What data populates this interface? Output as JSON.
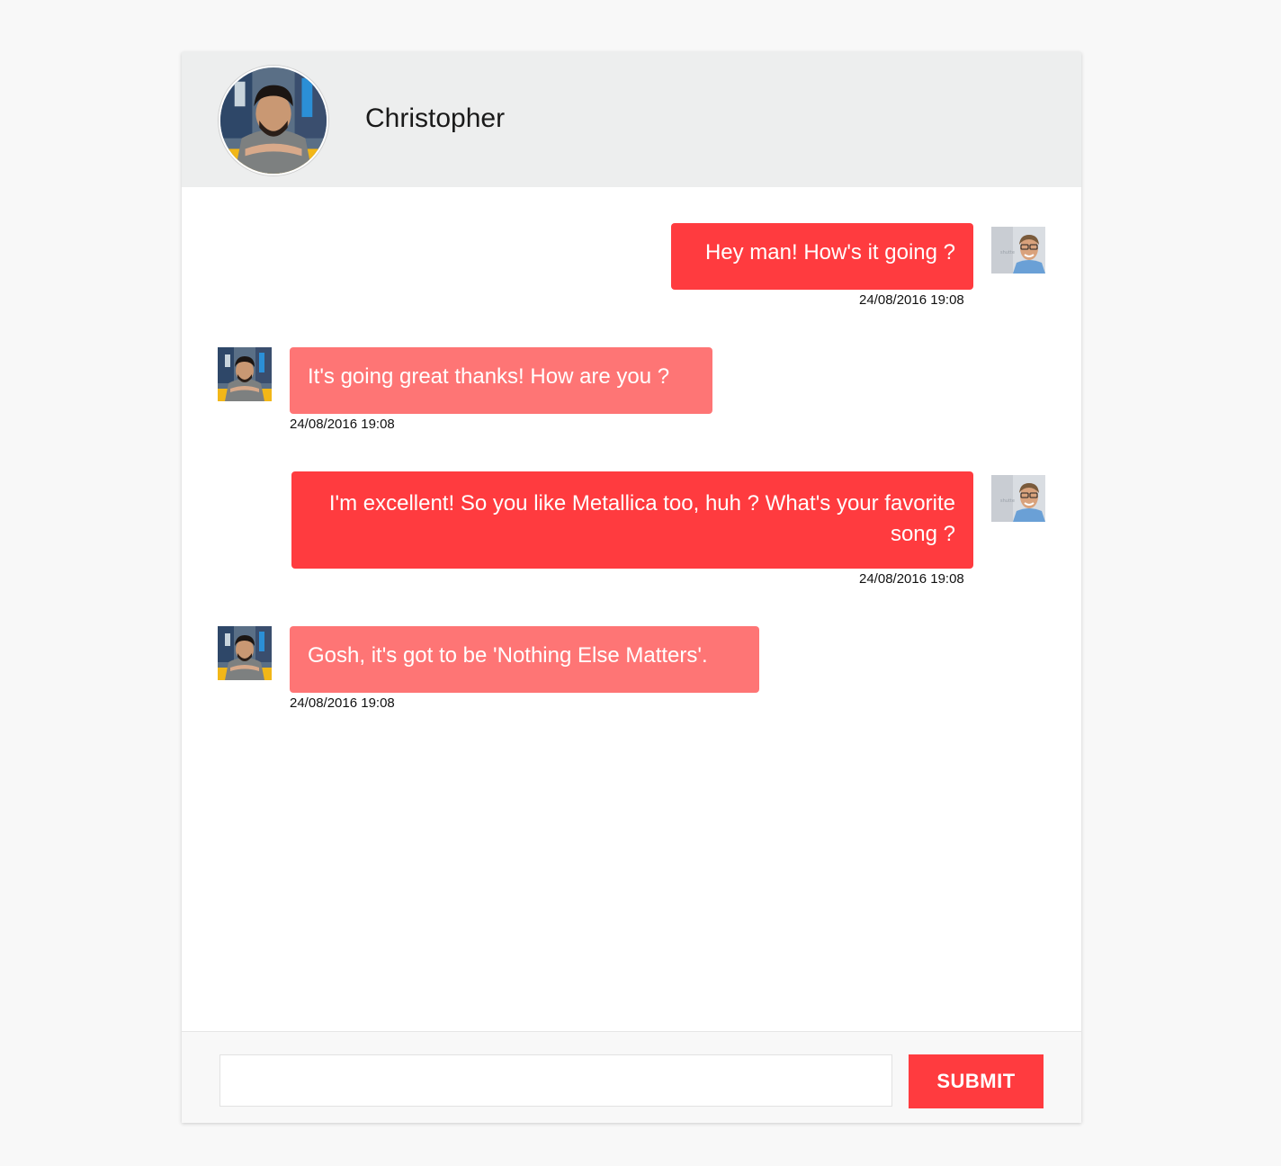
{
  "contact": {
    "name": "Christopher"
  },
  "messages": [
    {
      "direction": "out",
      "text": "Hey man! How's it going ?",
      "time": "24/08/2016 19:08"
    },
    {
      "direction": "in",
      "text": "It's going great thanks! How are you ?",
      "time": "24/08/2016 19:08"
    },
    {
      "direction": "out",
      "text": "I'm excellent! So you like Metallica too, huh ? What's your favorite song ?",
      "time": "24/08/2016 19:08"
    },
    {
      "direction": "in",
      "text": "Gosh, it's got to be 'Nothing Else Matters'.",
      "time": "24/08/2016 19:08"
    }
  ],
  "composer": {
    "value": "",
    "placeholder": "",
    "submit_label": "SUBMIT"
  },
  "colors": {
    "outgoing_bubble": "#ff3b3f",
    "incoming_bubble": "#fe7575",
    "header_bg": "#edeeee",
    "submit_bg": "#ff3b3f"
  },
  "icons": {
    "contact_avatar": "contact-photo-avatar",
    "self_avatar": "self-photo-avatar"
  }
}
